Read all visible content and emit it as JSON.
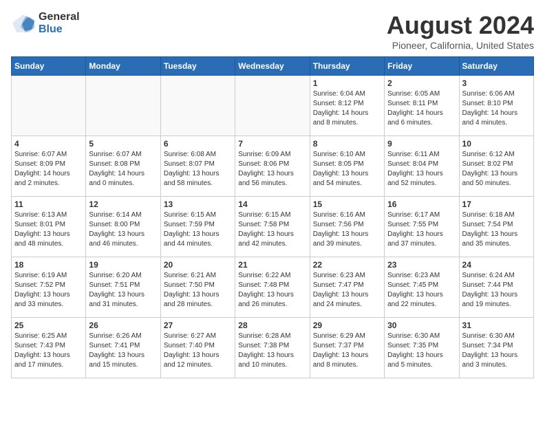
{
  "logo": {
    "text_general": "General",
    "text_blue": "Blue"
  },
  "title": "August 2024",
  "subtitle": "Pioneer, California, United States",
  "days_of_week": [
    "Sunday",
    "Monday",
    "Tuesday",
    "Wednesday",
    "Thursday",
    "Friday",
    "Saturday"
  ],
  "weeks": [
    [
      {
        "day": "",
        "info": ""
      },
      {
        "day": "",
        "info": ""
      },
      {
        "day": "",
        "info": ""
      },
      {
        "day": "",
        "info": ""
      },
      {
        "day": "1",
        "info": "Sunrise: 6:04 AM\nSunset: 8:12 PM\nDaylight: 14 hours\nand 8 minutes."
      },
      {
        "day": "2",
        "info": "Sunrise: 6:05 AM\nSunset: 8:11 PM\nDaylight: 14 hours\nand 6 minutes."
      },
      {
        "day": "3",
        "info": "Sunrise: 6:06 AM\nSunset: 8:10 PM\nDaylight: 14 hours\nand 4 minutes."
      }
    ],
    [
      {
        "day": "4",
        "info": "Sunrise: 6:07 AM\nSunset: 8:09 PM\nDaylight: 14 hours\nand 2 minutes."
      },
      {
        "day": "5",
        "info": "Sunrise: 6:07 AM\nSunset: 8:08 PM\nDaylight: 14 hours\nand 0 minutes."
      },
      {
        "day": "6",
        "info": "Sunrise: 6:08 AM\nSunset: 8:07 PM\nDaylight: 13 hours\nand 58 minutes."
      },
      {
        "day": "7",
        "info": "Sunrise: 6:09 AM\nSunset: 8:06 PM\nDaylight: 13 hours\nand 56 minutes."
      },
      {
        "day": "8",
        "info": "Sunrise: 6:10 AM\nSunset: 8:05 PM\nDaylight: 13 hours\nand 54 minutes."
      },
      {
        "day": "9",
        "info": "Sunrise: 6:11 AM\nSunset: 8:04 PM\nDaylight: 13 hours\nand 52 minutes."
      },
      {
        "day": "10",
        "info": "Sunrise: 6:12 AM\nSunset: 8:02 PM\nDaylight: 13 hours\nand 50 minutes."
      }
    ],
    [
      {
        "day": "11",
        "info": "Sunrise: 6:13 AM\nSunset: 8:01 PM\nDaylight: 13 hours\nand 48 minutes."
      },
      {
        "day": "12",
        "info": "Sunrise: 6:14 AM\nSunset: 8:00 PM\nDaylight: 13 hours\nand 46 minutes."
      },
      {
        "day": "13",
        "info": "Sunrise: 6:15 AM\nSunset: 7:59 PM\nDaylight: 13 hours\nand 44 minutes."
      },
      {
        "day": "14",
        "info": "Sunrise: 6:15 AM\nSunset: 7:58 PM\nDaylight: 13 hours\nand 42 minutes."
      },
      {
        "day": "15",
        "info": "Sunrise: 6:16 AM\nSunset: 7:56 PM\nDaylight: 13 hours\nand 39 minutes."
      },
      {
        "day": "16",
        "info": "Sunrise: 6:17 AM\nSunset: 7:55 PM\nDaylight: 13 hours\nand 37 minutes."
      },
      {
        "day": "17",
        "info": "Sunrise: 6:18 AM\nSunset: 7:54 PM\nDaylight: 13 hours\nand 35 minutes."
      }
    ],
    [
      {
        "day": "18",
        "info": "Sunrise: 6:19 AM\nSunset: 7:52 PM\nDaylight: 13 hours\nand 33 minutes."
      },
      {
        "day": "19",
        "info": "Sunrise: 6:20 AM\nSunset: 7:51 PM\nDaylight: 13 hours\nand 31 minutes."
      },
      {
        "day": "20",
        "info": "Sunrise: 6:21 AM\nSunset: 7:50 PM\nDaylight: 13 hours\nand 28 minutes."
      },
      {
        "day": "21",
        "info": "Sunrise: 6:22 AM\nSunset: 7:48 PM\nDaylight: 13 hours\nand 26 minutes."
      },
      {
        "day": "22",
        "info": "Sunrise: 6:23 AM\nSunset: 7:47 PM\nDaylight: 13 hours\nand 24 minutes."
      },
      {
        "day": "23",
        "info": "Sunrise: 6:23 AM\nSunset: 7:45 PM\nDaylight: 13 hours\nand 22 minutes."
      },
      {
        "day": "24",
        "info": "Sunrise: 6:24 AM\nSunset: 7:44 PM\nDaylight: 13 hours\nand 19 minutes."
      }
    ],
    [
      {
        "day": "25",
        "info": "Sunrise: 6:25 AM\nSunset: 7:43 PM\nDaylight: 13 hours\nand 17 minutes."
      },
      {
        "day": "26",
        "info": "Sunrise: 6:26 AM\nSunset: 7:41 PM\nDaylight: 13 hours\nand 15 minutes."
      },
      {
        "day": "27",
        "info": "Sunrise: 6:27 AM\nSunset: 7:40 PM\nDaylight: 13 hours\nand 12 minutes."
      },
      {
        "day": "28",
        "info": "Sunrise: 6:28 AM\nSunset: 7:38 PM\nDaylight: 13 hours\nand 10 minutes."
      },
      {
        "day": "29",
        "info": "Sunrise: 6:29 AM\nSunset: 7:37 PM\nDaylight: 13 hours\nand 8 minutes."
      },
      {
        "day": "30",
        "info": "Sunrise: 6:30 AM\nSunset: 7:35 PM\nDaylight: 13 hours\nand 5 minutes."
      },
      {
        "day": "31",
        "info": "Sunrise: 6:30 AM\nSunset: 7:34 PM\nDaylight: 13 hours\nand 3 minutes."
      }
    ]
  ]
}
